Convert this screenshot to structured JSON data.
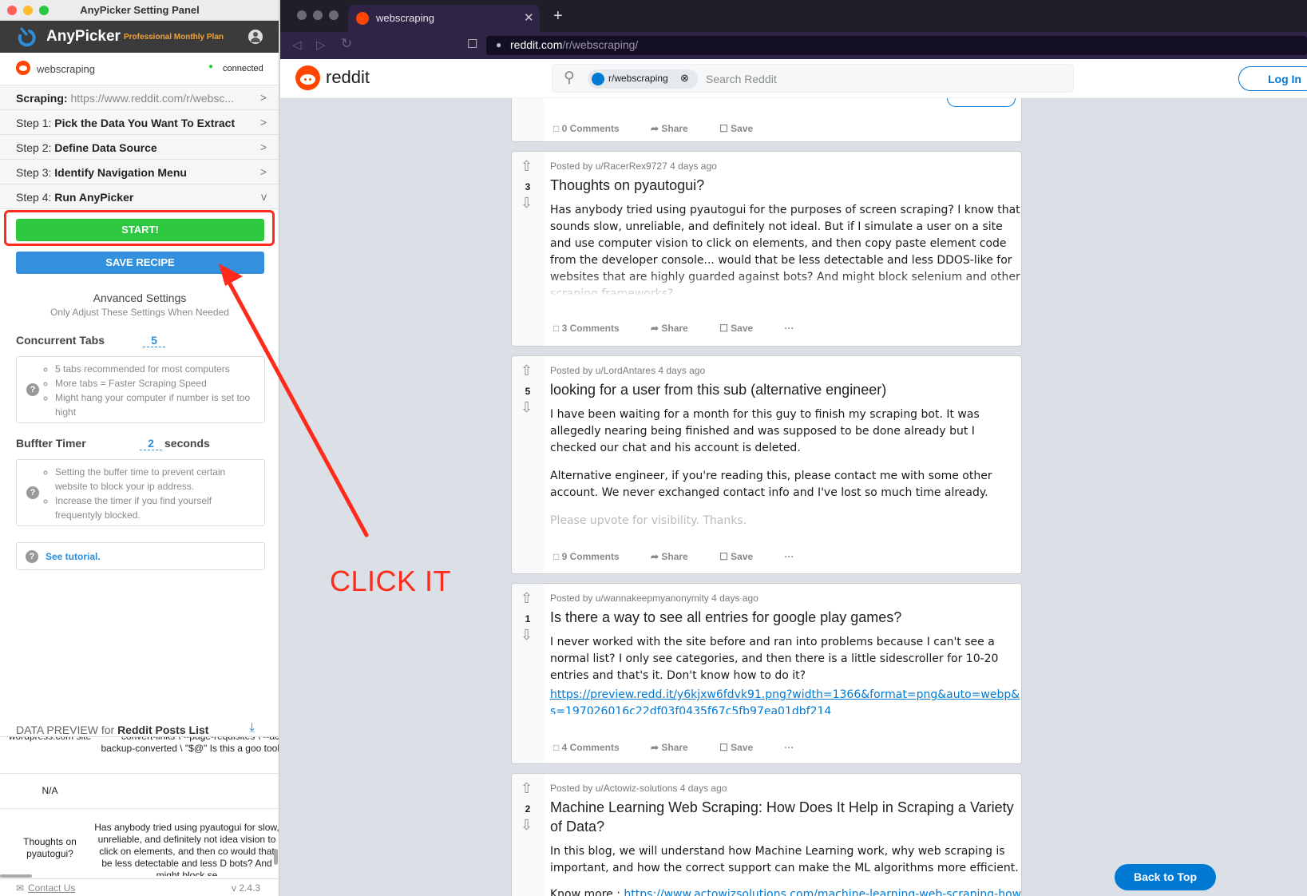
{
  "anypicker": {
    "window_title": "AnyPicker Setting Panel",
    "brand": "AnyPicker",
    "plan": "Professional Monthly Plan",
    "site_name": "webscraping",
    "status": "connected",
    "scraping_label": "Scraping:",
    "scraping_url": "https://www.reddit.com/r/websc...",
    "steps": [
      {
        "prefix": "Step 1:",
        "label": "Pick the Data You Want To Extract",
        "chev": ">"
      },
      {
        "prefix": "Step 2:",
        "label": "Define Data Source",
        "chev": ">"
      },
      {
        "prefix": "Step 3:",
        "label": "Identify Navigation Menu",
        "chev": ">"
      },
      {
        "prefix": "Step 4:",
        "label": "Run AnyPicker",
        "chev": "v"
      }
    ],
    "start_label": "START!",
    "save_label": "SAVE RECIPE",
    "advanced_title": "Anvanced Settings",
    "advanced_sub": "Only Adjust These Settings When Needed",
    "concurrent_label": "Concurrent Tabs",
    "concurrent_value": "5",
    "concurrent_notes": [
      "5 tabs recommended for most computers",
      "More tabs = Faster Scraping Speed",
      "Might hang your computer if number is set too hight"
    ],
    "buffer_label": "Buffter Timer",
    "buffer_value": "2",
    "buffer_unit": "seconds",
    "buffer_notes": [
      "Setting the buffer time to prevent certain website to block your ip address.",
      "Increase the timer if you find yourself frequentyly blocked."
    ],
    "tutorial": "See tutorial.",
    "preview_prefix": "DATA PREVIEW for",
    "preview_name": "Reddit Posts List",
    "preview_rows": [
      {
        "a": "wordpress.com site",
        "b": "convert-links \\ --page-requisites \\ --ac backup-converted \\ \"$@\" Is this a goo tool"
      },
      {
        "a": "N/A",
        "b": ""
      },
      {
        "a": "Thoughts on pyautogui?",
        "b": "Has anybody tried using pyautogui for slow, unreliable, and definitely not idea vision to click on elements, and then co would that be less detectable and less D bots? And might block se"
      }
    ],
    "contact": "Contact Us",
    "version": "v 2.4.3"
  },
  "browser": {
    "tab_title": "webscraping",
    "url_host": "reddit.com",
    "url_path": "/r/webscraping/",
    "reddit_logo": "reddit",
    "search_chip": "r/webscraping",
    "search_placeholder": "Search Reddit",
    "login": "Log In",
    "back_to_top": "Back to Top"
  },
  "top_post_actions": {
    "comments": "0 Comments",
    "share": "Share",
    "save": "Save"
  },
  "posts": [
    {
      "score": "3",
      "meta": "Posted by u/RacerRex9727 4 days ago",
      "title": "Thoughts on pyautogui?",
      "body": [
        "Has anybody tried using pyautogui for the purposes of screen scraping? I know that sounds slow, unreliable, and definitely not ideal. But if I simulate a user on a site and use computer vision to click on elements, and then copy paste element code from the developer console... would that be less detectable and less DDOS-like for websites that are highly guarded against bots? And might block selenium and other scraping frameworks?"
      ],
      "comments": "3 Comments",
      "share": "Share",
      "save": "Save",
      "more": "···"
    },
    {
      "score": "5",
      "meta": "Posted by u/LordAntares 4 days ago",
      "title": "looking for a user from this sub (alternative engineer)",
      "body": [
        "I have been waiting for a month for this guy to finish my scraping bot. It was allegedly nearing being finished and was supposed to be done already but I checked our chat and his account is deleted.",
        "Alternative engineer, if you're reading this, please contact me with some other account. We never exchanged contact info and I've lost so much time already.",
        "Please upvote for visibility. Thanks."
      ],
      "comments": "9 Comments",
      "share": "Share",
      "save": "Save",
      "more": "···"
    },
    {
      "score": "1",
      "meta": "Posted by u/wannakeepmyanonymity 4 days ago",
      "title": "Is there a way to see all entries for google play games?",
      "body": [
        "I never worked with the site before and ran into problems because I can't see a normal list? I only see categories, and then there is a little sidescroller for 10-20 entries and that's it. Don't know how to do it?"
      ],
      "link": "https://preview.redd.it/y6kjxw6fdvk91.png?width=1366&format=png&auto=webp&s=197026016c22df03f0435f67c5fb97ea01dbf214",
      "comments": "4 Comments",
      "share": "Share",
      "save": "Save",
      "more": "···"
    },
    {
      "score": "2",
      "meta": "Posted by u/Actowiz-solutions 4 days ago",
      "title": "Machine Learning Web Scraping: How Does It Help in Scraping a Variety of Data?",
      "body": [
        "In this blog, we will understand how Machine Learning work, why web scraping is important, and how the correct support can make the ML algorithms more efficient."
      ],
      "more_prefix": "Know more :",
      "more_link": "https://www.actowizsolutions.com/machine-learning-web-scraping-how"
    }
  ],
  "annotation": {
    "text": "CLICK IT",
    "color": "#ff2a1a"
  },
  "colors": {
    "start": "#2ec840",
    "save": "#3290dc",
    "reddit": "#ff4500",
    "link": "#0079d3"
  }
}
